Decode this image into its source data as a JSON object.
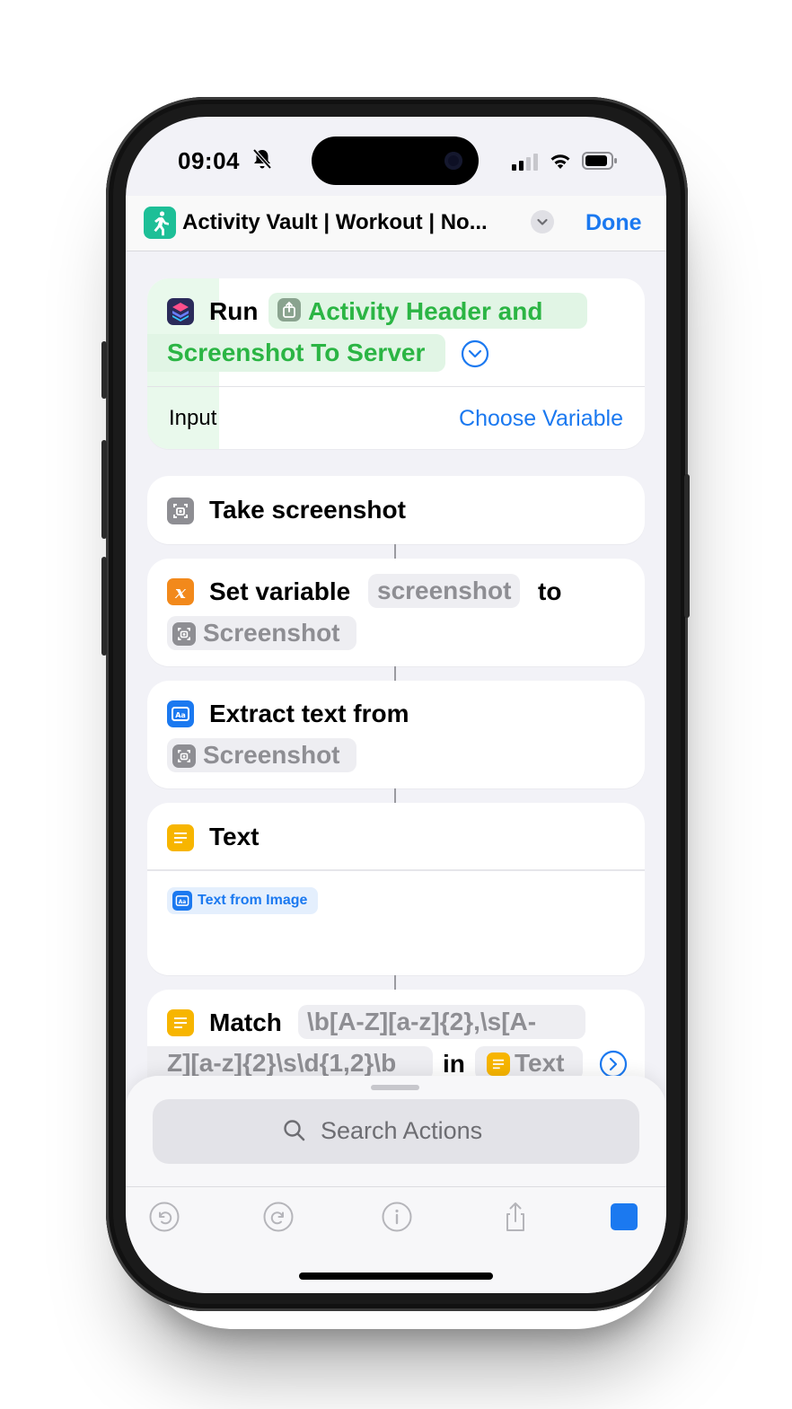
{
  "status_bar": {
    "time": "09:04"
  },
  "nav": {
    "title": "Activity Vault | Workout | No...",
    "done": "Done"
  },
  "actions": {
    "run": {
      "verb": "Run",
      "shortcut_line1": "Activity Header and",
      "shortcut_line2": "Screenshot To Server",
      "input_label": "Input",
      "input_value": "Choose Variable"
    },
    "take_screenshot": {
      "label": "Take screenshot"
    },
    "set_variable": {
      "verb": "Set variable",
      "var_name": "screenshot",
      "to": "to",
      "value": "Screenshot"
    },
    "extract_text": {
      "verb": "Extract text from",
      "value": "Screenshot"
    },
    "text": {
      "label": "Text",
      "token": "Text from Image"
    },
    "match": {
      "verb": "Match",
      "pattern_line1": "\\b[A-Z][a-z]{2},\\s[A-",
      "pattern_line2": "Z][a-z]{2}\\s\\d{1,2}\\b",
      "in": "in",
      "target": "Text"
    }
  },
  "bottom_sheet": {
    "search_placeholder": "Search Actions"
  },
  "colors": {
    "accent": "#1b79f0",
    "green": "#2bb544",
    "orange": "#f2891b",
    "yellow": "#f7b500",
    "app_teal": "#1dbf97"
  }
}
